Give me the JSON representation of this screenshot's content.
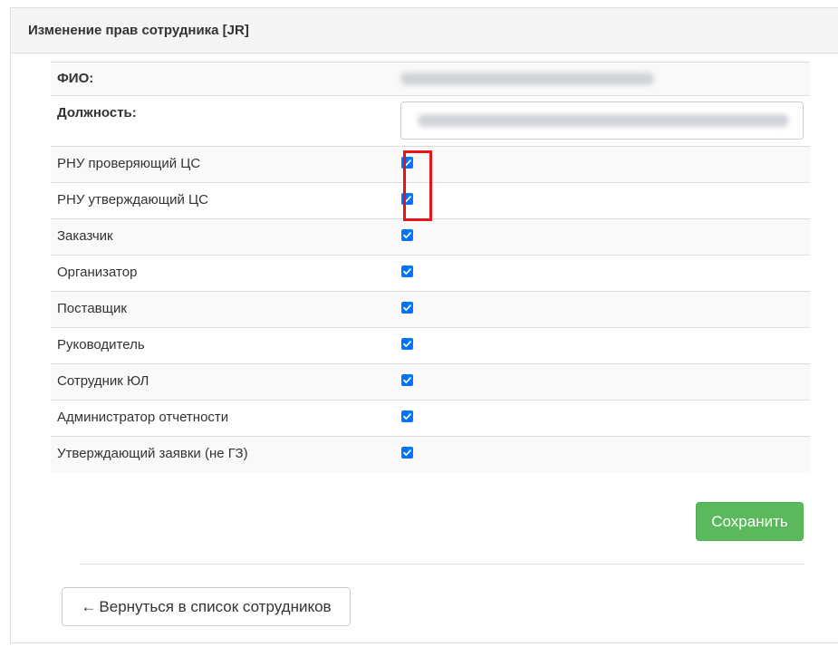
{
  "panel": {
    "title": "Изменение прав сотрудника [JR]"
  },
  "fields": {
    "fio_label": "ФИО:",
    "fio_value": "",
    "position_label": "Должность:",
    "position_value": ""
  },
  "roles": [
    {
      "label": "РНУ проверяющий ЦС",
      "checked": true
    },
    {
      "label": "РНУ утверждающий ЦС",
      "checked": true
    },
    {
      "label": "Заказчик",
      "checked": true
    },
    {
      "label": "Организатор",
      "checked": true
    },
    {
      "label": "Поставщик",
      "checked": true
    },
    {
      "label": "Руководитель",
      "checked": true
    },
    {
      "label": "Сотрудник ЮЛ",
      "checked": true
    },
    {
      "label": "Администратор отчетности",
      "checked": true
    },
    {
      "label": "Утверждающий заявки (не ГЗ)",
      "checked": true
    }
  ],
  "actions": {
    "save_label": "Сохранить",
    "back_arrow": "←",
    "back_label": "Вернуться в список сотрудников"
  },
  "colors": {
    "checkbox": "#0075ff",
    "save_button": "#5cb85c",
    "highlight": "#e8121a"
  }
}
